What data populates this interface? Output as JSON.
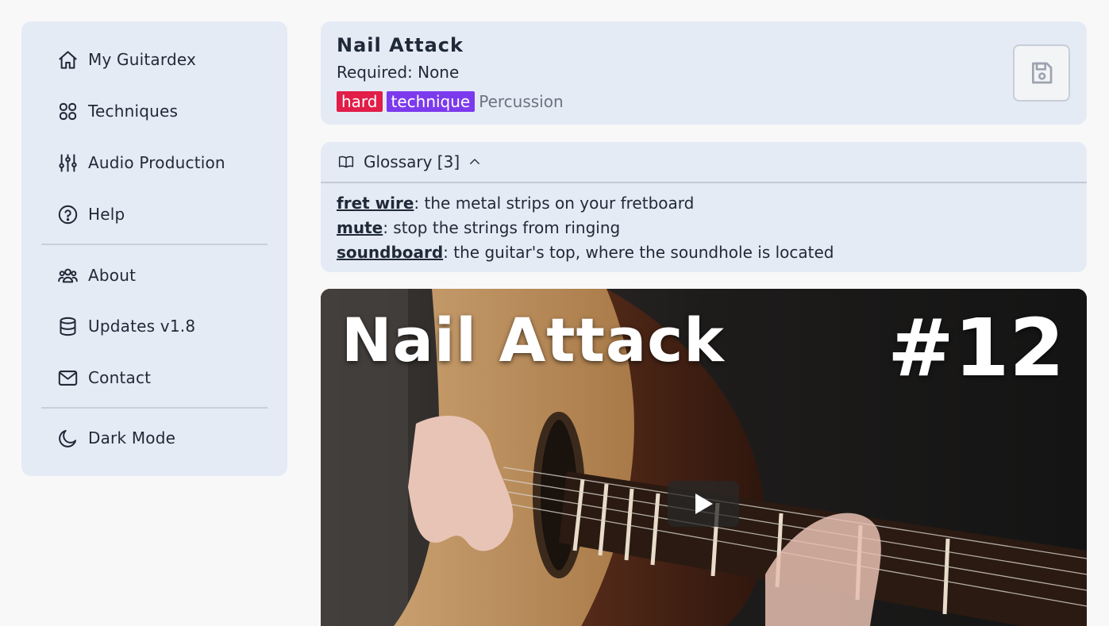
{
  "sidebar": {
    "items": [
      {
        "label": "My Guitardex",
        "icon": "home-icon"
      },
      {
        "label": "Techniques",
        "icon": "grid-icon"
      },
      {
        "label": "Audio Production",
        "icon": "sliders-icon"
      },
      {
        "label": "Help",
        "icon": "help-circle-icon"
      },
      {
        "label": "About",
        "icon": "users-icon"
      },
      {
        "label": "Updates v1.8",
        "icon": "database-icon"
      },
      {
        "label": "Contact",
        "icon": "mail-icon"
      },
      {
        "label": "Dark Mode",
        "icon": "moon-icon"
      }
    ]
  },
  "technique": {
    "title": "Nail Attack",
    "required": "Required: None",
    "tags": [
      {
        "label": "hard",
        "color": "#e11d48"
      },
      {
        "label": "technique",
        "color": "#7c3aed"
      },
      {
        "label": "Percussion",
        "color": "#6b7280"
      }
    ]
  },
  "glossary": {
    "header": "Glossary [3]",
    "items": [
      {
        "term": "fret wire",
        "definition": ": the metal strips on your fretboard"
      },
      {
        "term": "mute",
        "definition": ": stop the strings from ringing"
      },
      {
        "term": "soundboard",
        "definition": ": the guitar's top, where the soundhole is located"
      }
    ]
  },
  "video": {
    "title": "Nail Attack",
    "number": "#12"
  },
  "colors": {
    "panel": "#e5ebf5",
    "background": "#f8f8f9",
    "tag_hard": "#e11d48",
    "tag_technique": "#7c3aed"
  }
}
